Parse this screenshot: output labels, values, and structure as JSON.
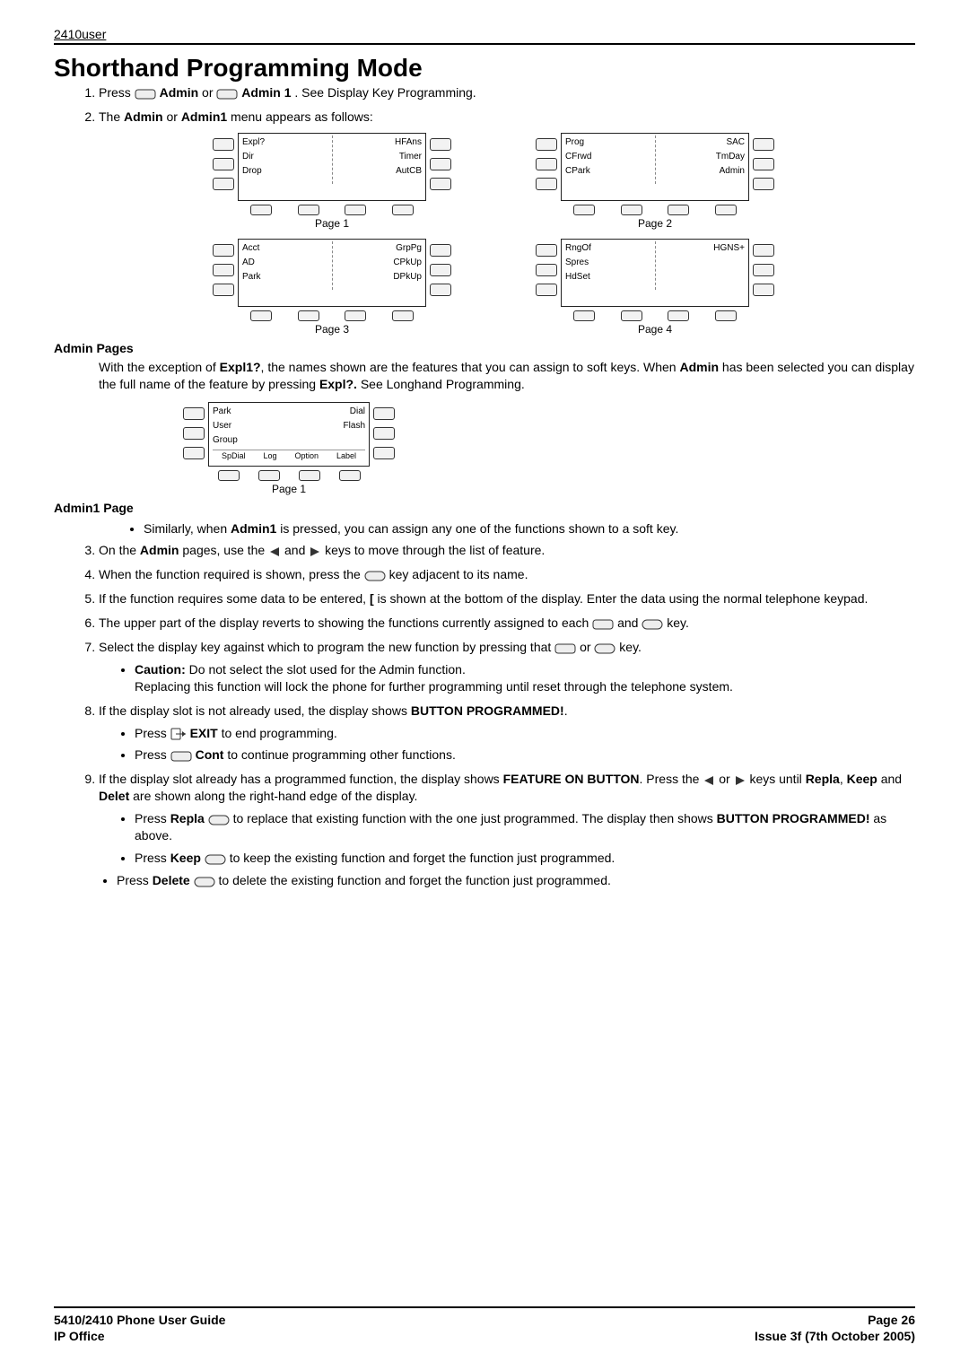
{
  "header": "2410user",
  "title": "Shorthand Programming Mode",
  "steps": {
    "s1_a": "Press ",
    "s1_b": " Admin",
    "s1_c": " or ",
    "s1_d": " Admin 1",
    "s1_e": ". See Display Key Programming.",
    "s2_a": "The ",
    "s2_b": "Admin",
    "s2_c": " or ",
    "s2_d": "Admin1",
    "s2_e": " menu appears as follows:",
    "s3_a": "On the ",
    "s3_b": "Admin",
    "s3_c": " pages, use the ",
    "s3_d": " and ",
    "s3_e": " keys to move through the list of feature.",
    "s4_a": "When the function required is shown, press the ",
    "s4_b": "key adjacent to its name.",
    "s5_a": "If the function requires some data to be entered, ",
    "s5_b": "[",
    "s5_c": " is shown at the bottom of the display. Enter the data using the normal telephone keypad.",
    "s6_a": "The upper part of the display reverts to showing the functions currently assigned to each ",
    "s6_b": " and ",
    "s6_c": "key.",
    "s7_a": "Select the display key against which to program the new function by pressing that ",
    "s7_b": " or ",
    "s7_c": "key.",
    "s7_caution_a": "Caution:",
    "s7_caution_b": "  Do not select the slot used for the Admin function.",
    "s7_caution_c": "Replacing this function will lock the phone for further programming until reset through the telephone system.",
    "s8_a": "If the display slot is not already used, the display shows ",
    "s8_b": "BUTTON PROGRAMMED!",
    "s8_c": ".",
    "s8_sub1_a": "Press",
    "s8_sub1_b": " EXIT",
    "s8_sub1_c": " to end programming.",
    "s8_sub2_a": "Press ",
    "s8_sub2_b": " Cont",
    "s8_sub2_c": " to continue programming other functions.",
    "s9_a": "If the display slot already has a programmed function, the display shows ",
    "s9_b": "FEATURE ON BUTTON",
    "s9_c": ". Press the ",
    "s9_d": " or ",
    "s9_e": " keys until ",
    "s9_f": "Repla",
    "s9_g": ", ",
    "s9_h": "Keep",
    "s9_i": " and ",
    "s9_j": "Delet",
    "s9_k": " are shown along the right-hand edge of the display.",
    "s9_sub1_a": "Press ",
    "s9_sub1_b": "Repla ",
    "s9_sub1_c": "to replace that existing function with the one just programmed. The display then shows ",
    "s9_sub1_d": "BUTTON PROGRAMMED!",
    "s9_sub1_e": " as above.",
    "s9_sub2_a": "Press ",
    "s9_sub2_b": "Keep ",
    "s9_sub2_c": "to keep the existing function and forget the function just programmed.",
    "s9_sub3_a": "Press ",
    "s9_sub3_b": "Delete ",
    "s9_sub3_c": "to delete the existing function and forget the function just programmed."
  },
  "adminPagesLabel": "Admin Pages",
  "adminPagesText_a": "With the exception of ",
  "adminPagesText_b": "Expl1?",
  "adminPagesText_c": ", the names shown are the features that you can assign to soft keys. When ",
  "adminPagesText_d": "Admin",
  "adminPagesText_e": " has been selected you can display the full name of the feature by pressing ",
  "adminPagesText_f": "Expl?.",
  "adminPagesText_g": " See Longhand Programming.",
  "admin1PageLabel": "Admin1 Page",
  "admin1Bullet_a": "Similarly, when ",
  "admin1Bullet_b": "Admin1",
  "admin1Bullet_c": " is pressed, you can assign any one of the functions shown to a soft key.",
  "panels": {
    "p1": {
      "left": [
        "Expl?",
        "Dir",
        "Drop"
      ],
      "right": [
        "HFAns",
        "Timer",
        "AutCB"
      ],
      "label": "Page 1"
    },
    "p2": {
      "left": [
        "Prog",
        "CFrwd",
        "CPark"
      ],
      "right": [
        "SAC",
        "TmDay",
        "Admin"
      ],
      "label": "Page 2"
    },
    "p3": {
      "left": [
        "Acct",
        "AD",
        "Park"
      ],
      "right": [
        "GrpPg",
        "CPkUp",
        "DPkUp"
      ],
      "label": "Page 3"
    },
    "p4": {
      "left": [
        "RngOf",
        "Spres",
        "HdSet"
      ],
      "right": [
        "HGNS+",
        "",
        ""
      ],
      "label": "Page 4"
    },
    "small": {
      "left": [
        "Park",
        "User",
        "Group"
      ],
      "right": [
        "Dial",
        "Flash",
        ""
      ],
      "bottom": [
        "SpDial",
        "Log",
        "Option",
        "Label"
      ],
      "label": "Page 1"
    }
  },
  "footer": {
    "leftTop": "5410/2410 Phone User Guide",
    "leftBottom": "IP Office",
    "rightTop": "Page 26",
    "rightBottom": "Issue 3f (7th October 2005)"
  }
}
